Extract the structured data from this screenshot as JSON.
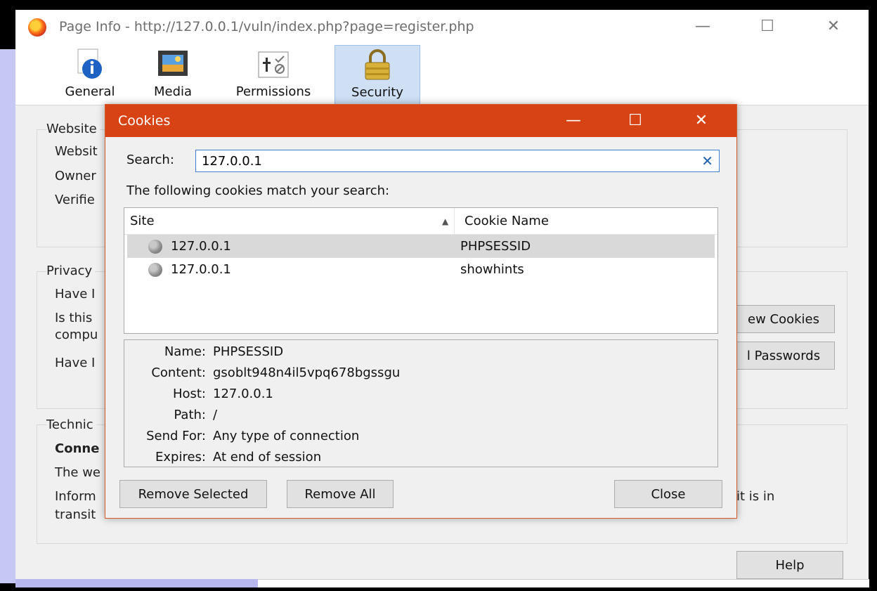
{
  "background_window": {
    "title": "Page Info - http://127.0.0.1/vuln/index.php?page=register.php",
    "tabs": [
      {
        "label": "General",
        "icon": "info-icon"
      },
      {
        "label": "Media",
        "icon": "media-icon"
      },
      {
        "label": "Permissions",
        "icon": "permissions-icon"
      },
      {
        "label": "Security",
        "icon": "lock-icon"
      }
    ],
    "active_tab": "Security",
    "groups": {
      "website": {
        "title": "Website",
        "lines": [
          "Websit",
          "Owner",
          "Verifie"
        ]
      },
      "privacy": {
        "title": "Privacy",
        "lines": [
          "Have I",
          "Is this",
          "compu",
          "Have I"
        ]
      },
      "technical": {
        "title": "Technic",
        "lines": [
          "Conne",
          "The we",
          "Inform",
          "transit"
        ],
        "trailing_text": "it is in"
      }
    },
    "buttons": {
      "view_cookies": "ew Cookies",
      "saved_passwords": "l Passwords",
      "help": "Help"
    }
  },
  "cookies_dialog": {
    "title": "Cookies",
    "search_label": "Search:",
    "search_value": "127.0.0.1",
    "match_text": "The following cookies match your search:",
    "columns": [
      "Site",
      "Cookie Name"
    ],
    "rows": [
      {
        "site": "127.0.0.1",
        "cookie_name": "PHPSESSID",
        "selected": true
      },
      {
        "site": "127.0.0.1",
        "cookie_name": "showhints",
        "selected": false
      }
    ],
    "details": {
      "name_label": "Name:",
      "name_value": "PHPSESSID",
      "content_label": "Content:",
      "content_value": "gsoblt948n4il5vpq678bgssgu",
      "host_label": "Host:",
      "host_value": "127.0.0.1",
      "path_label": "Path:",
      "path_value": "/",
      "sendfor_label": "Send For:",
      "sendfor_value": "Any type of connection",
      "expires_label": "Expires:",
      "expires_value": "At end of session"
    },
    "buttons": {
      "remove_selected": "Remove Selected",
      "remove_all": "Remove All",
      "close": "Close"
    }
  },
  "colors": {
    "dialog_titlebar": "#d84315",
    "selected_row": "#d9d9d9",
    "active_tab": "#cfe0f5"
  }
}
